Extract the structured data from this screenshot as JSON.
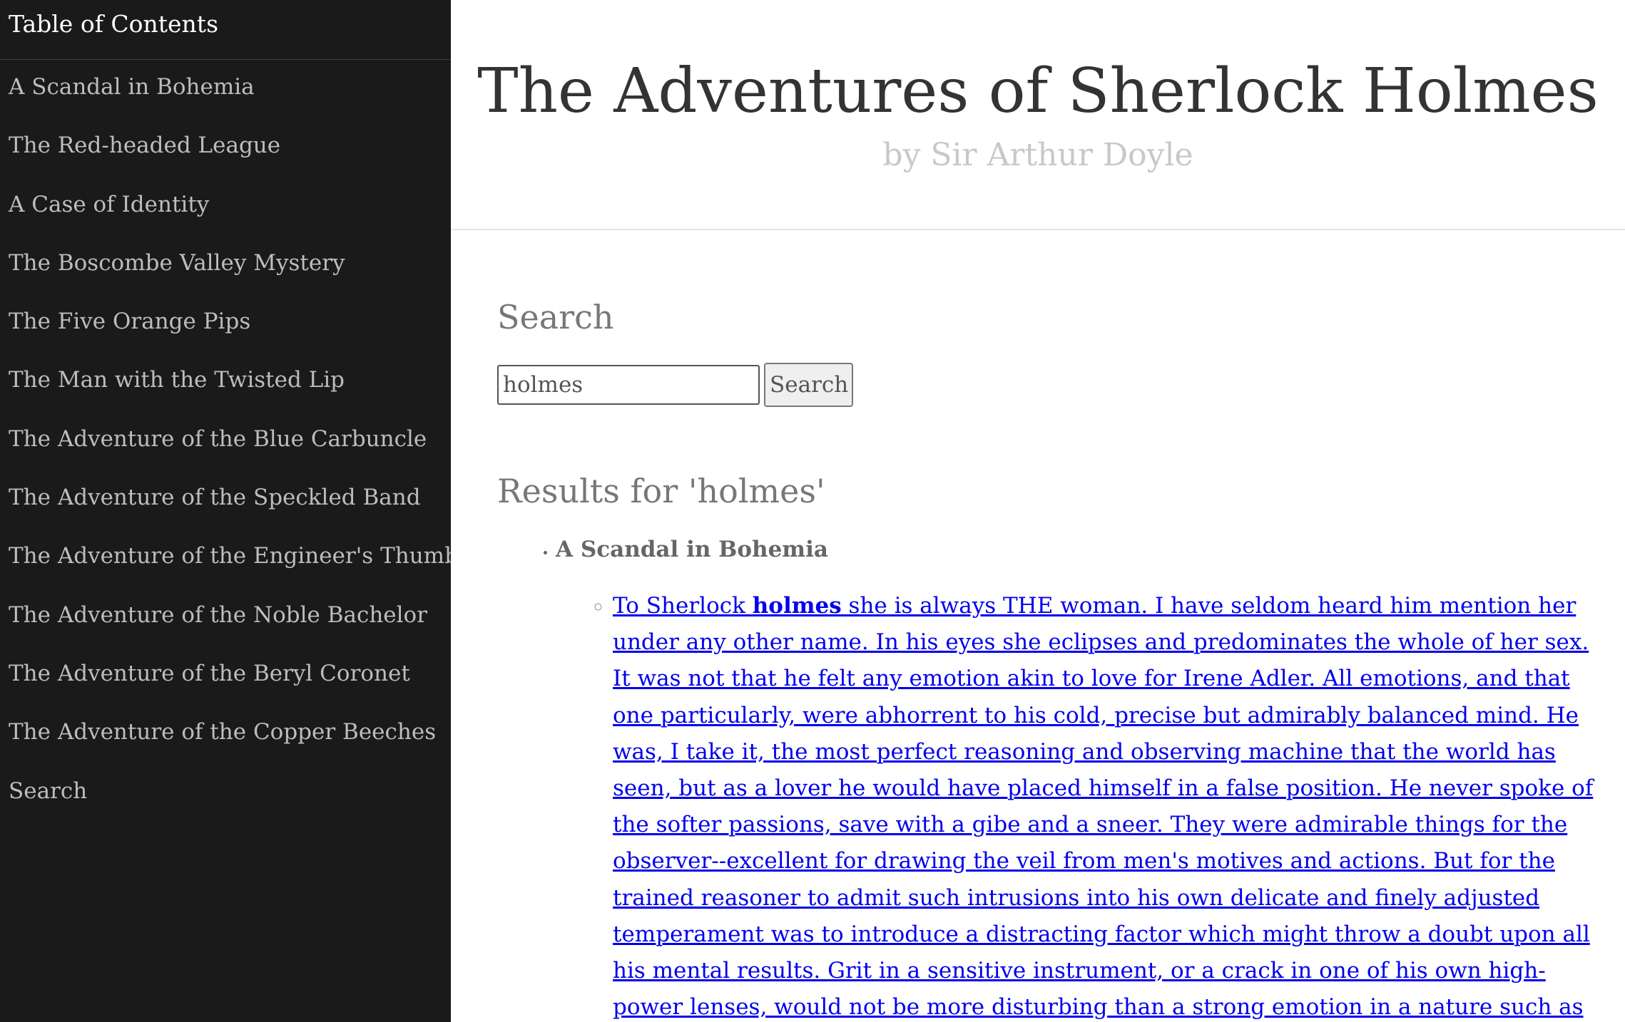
{
  "sidebar": {
    "title": "Table of Contents",
    "items": [
      {
        "label": "A Scandal in Bohemia"
      },
      {
        "label": "The Red-headed League"
      },
      {
        "label": "A Case of Identity"
      },
      {
        "label": "The Boscombe Valley Mystery"
      },
      {
        "label": "The Five Orange Pips"
      },
      {
        "label": "The Man with the Twisted Lip"
      },
      {
        "label": "The Adventure of the Blue Carbuncle"
      },
      {
        "label": "The Adventure of the Speckled Band"
      },
      {
        "label": "The Adventure of the Engineer's Thumb"
      },
      {
        "label": "The Adventure of the Noble Bachelor"
      },
      {
        "label": "The Adventure of the Beryl Coronet"
      },
      {
        "label": "The Adventure of the Copper Beeches"
      },
      {
        "label": "Search"
      }
    ]
  },
  "header": {
    "title": "The Adventures of Sherlock Holmes",
    "author": "by Sir Arthur Doyle"
  },
  "search": {
    "heading": "Search",
    "input_value": "holmes",
    "button_label": "Search"
  },
  "results": {
    "heading": "Results for 'holmes'",
    "chapters": [
      {
        "title": "A Scandal in Bohemia",
        "snippets": [
          {
            "before": "To Sherlock ",
            "match": "holmes",
            "after": " she is always THE woman. I have seldom heard him mention her under any other name. In his eyes she eclipses and predominates the whole of her sex. It was not that he felt any emotion akin to love for Irene Adler. All emotions, and that one particularly, were abhorrent to his cold, precise but admirably balanced mind. He was, I take it, the most perfect reasoning and observing machine that the world has seen, but as a lover he would have placed himself in a false position. He never spoke of the softer passions, save with a gibe and a sneer. They were admirable things for the observer--excellent for drawing the veil from men's motives and actions. But for the trained reasoner to admit such intrusions into his own delicate and finely adjusted temperament was to introduce a distracting factor which might throw a doubt upon all his mental results. Grit in a sensitive instrument, or a crack in one of his own high-power lenses, would not be more disturbing than a strong emotion in a nature such as his. And yet there was but one woman to him,"
          }
        ]
      }
    ]
  },
  "colors": {
    "sidebar_bg": "#1a1a1a",
    "sidebar_text": "#bdbdbd",
    "link": "#0000ee",
    "heading_gray": "#777777"
  }
}
